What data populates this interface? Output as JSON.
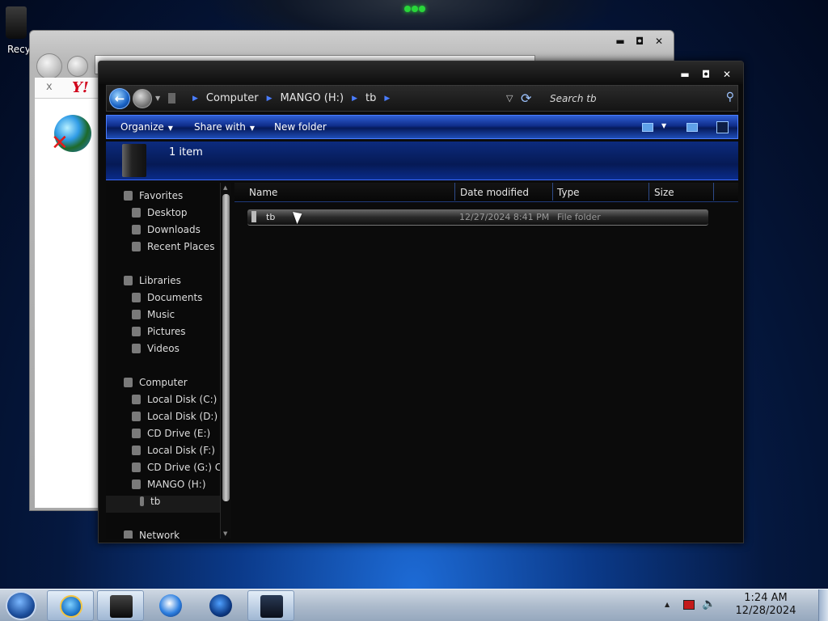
{
  "desktop": {
    "recycle_bin_label": "Recy"
  },
  "browser_window": {
    "tab_close": "x",
    "logo_text": "Y!"
  },
  "explorer": {
    "breadcrumb": [
      "Computer",
      "MANGO (H:)",
      "tb"
    ],
    "search_placeholder": "Search tb",
    "toolbar": {
      "organize": "Organize",
      "share_with": "Share with",
      "new_folder": "New folder"
    },
    "details_text": "1 item",
    "navigation": {
      "favorites": {
        "label": "Favorites",
        "items": [
          "Desktop",
          "Downloads",
          "Recent Places"
        ]
      },
      "libraries": {
        "label": "Libraries",
        "items": [
          "Documents",
          "Music",
          "Pictures",
          "Videos"
        ]
      },
      "computer": {
        "label": "Computer",
        "items": [
          "Local Disk (C:)",
          "Local Disk (D:)",
          "CD Drive (E:)",
          "Local Disk (F:)",
          "CD Drive (G:) CD_",
          "MANGO (H:)"
        ]
      },
      "current_folder": "tb",
      "network": "Network"
    },
    "columns": [
      "Name",
      "Date modified",
      "Type",
      "Size"
    ],
    "files": [
      {
        "name": "tb",
        "date_modified": "12/27/2024 8:41 PM",
        "type": "File folder",
        "size": ""
      }
    ]
  },
  "taskbar": {
    "time": "1:24 AM",
    "date": "12/28/2024"
  }
}
